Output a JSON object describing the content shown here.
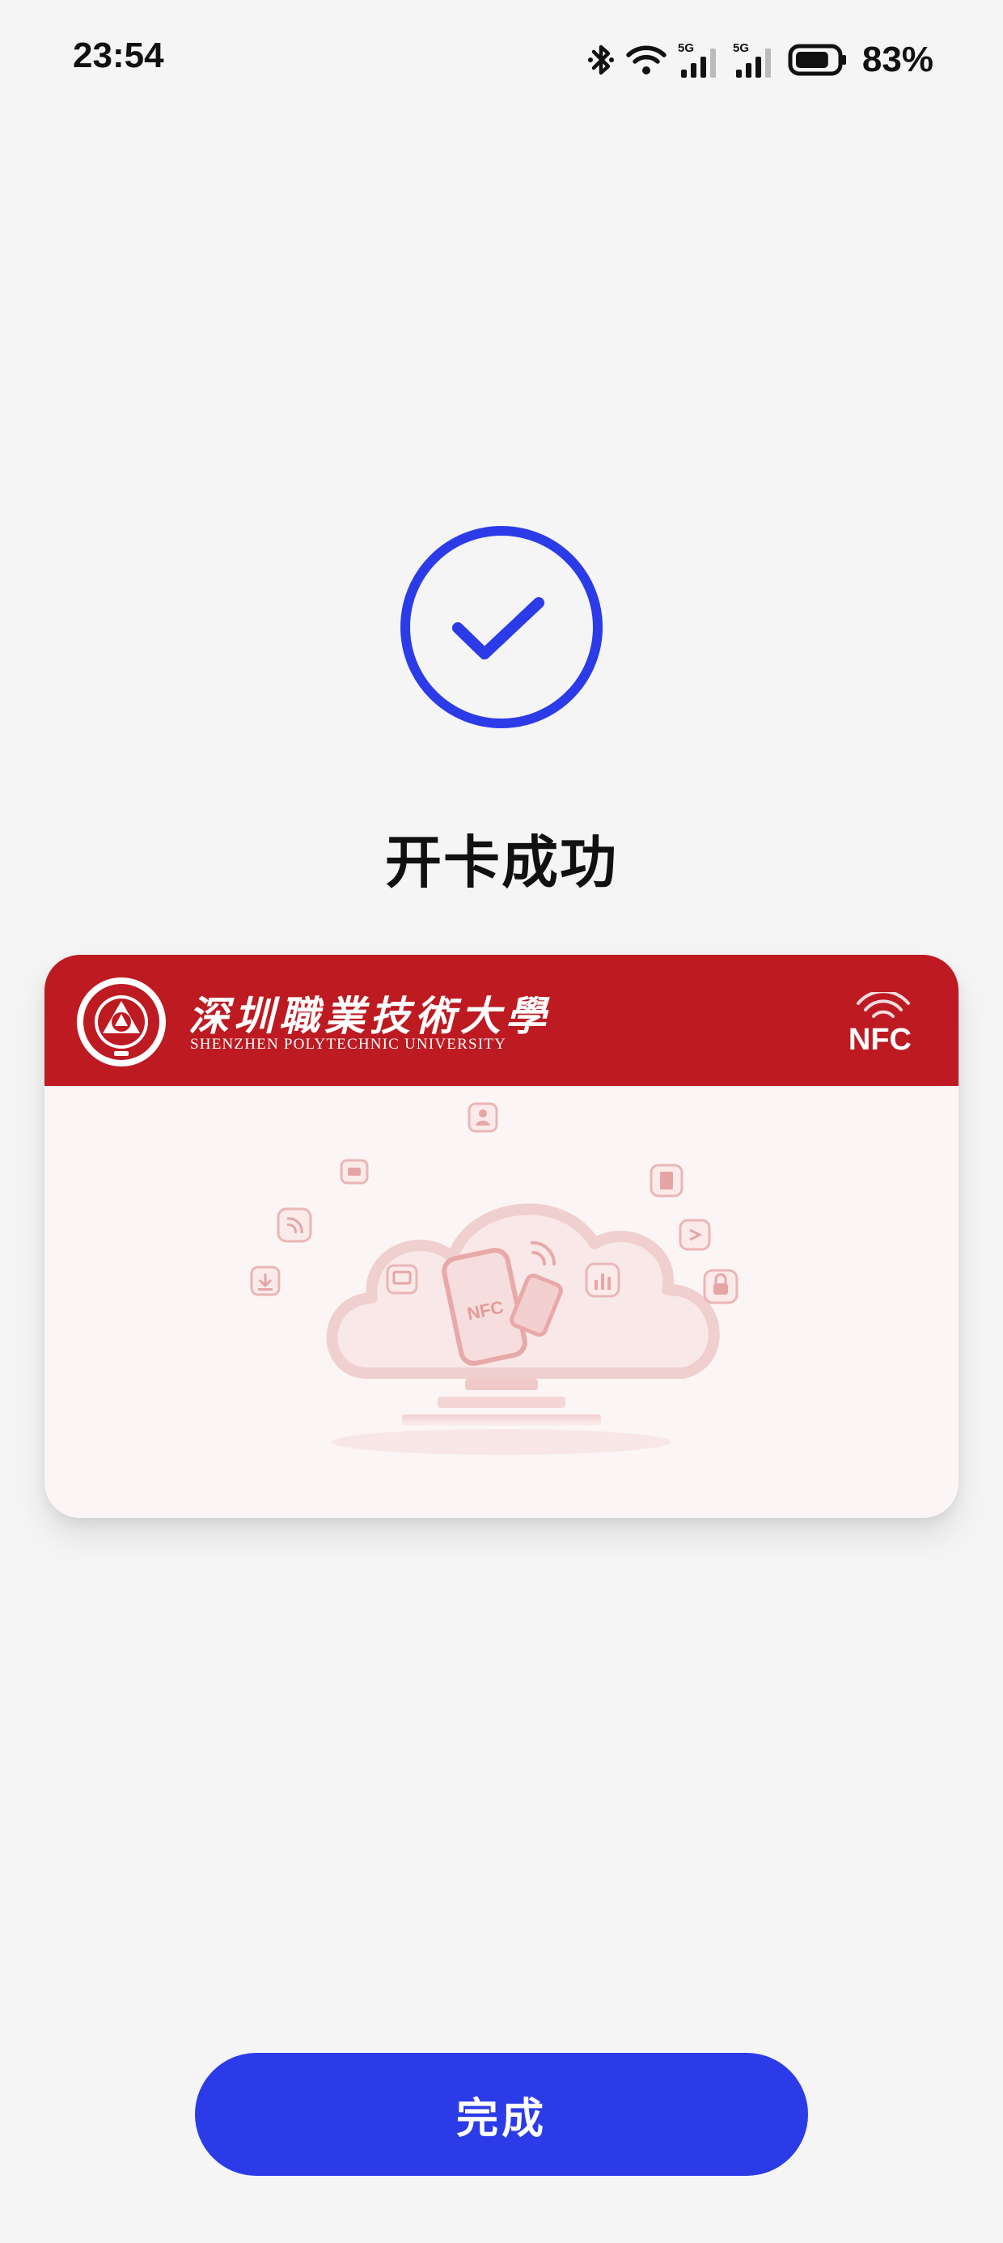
{
  "status_bar": {
    "time": "23:54",
    "battery_percent": "83%",
    "battery_level": 0.83,
    "network_label_1": "5G",
    "network_label_2": "5G",
    "icons": [
      "bluetooth-icon",
      "wifi-icon",
      "signal-5g-icon",
      "signal-5g-icon",
      "battery-icon"
    ]
  },
  "success": {
    "title": "开卡成功",
    "icon": "check-circle-icon",
    "accent_color": "#2c3be8"
  },
  "card": {
    "school_name_cn": "深圳職業技術大學",
    "school_name_en": "SHENZHEN POLYTECHNIC UNIVERSITY",
    "nfc_label": "NFC",
    "phone_label": "NFC",
    "header_color": "#bd1a21",
    "icons": [
      "university-logo",
      "nfc-waves-icon",
      "cloud-illustration",
      "phone-icon",
      "user-icon",
      "document-icon",
      "message-icon",
      "wifi-box-icon",
      "monitor-icon",
      "chart-icon",
      "share-icon",
      "lock-icon",
      "download-icon"
    ]
  },
  "actions": {
    "done_label": "完成"
  }
}
